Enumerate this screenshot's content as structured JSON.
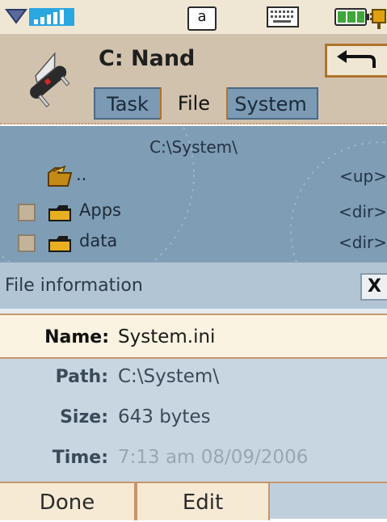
{
  "status_bar": {
    "input_mode": "a",
    "icons": [
      "signal-chevron-icon",
      "signal-bars-icon",
      "keyboard-icon",
      "battery-icon",
      "charger-plug-icon"
    ]
  },
  "header": {
    "drive_title": "C: Nand",
    "back_icon": "back-arrow-icon",
    "app_icon": "swiss-army-knife-icon",
    "tabs": [
      {
        "label": "Task"
      },
      {
        "label": "File",
        "active": true
      },
      {
        "label": "System"
      }
    ]
  },
  "folder_list": {
    "current_path": "C:\\System\\",
    "rows": [
      {
        "name": "..",
        "type": "<up>",
        "icon": "up-folder-icon",
        "checkbox": false
      },
      {
        "name": "Apps",
        "type": "<dir>",
        "icon": "folder-icon",
        "checkbox": true
      },
      {
        "name": "data",
        "type": "<dir>",
        "icon": "folder-icon",
        "checkbox": true
      }
    ]
  },
  "file_info": {
    "title": "File information",
    "close_label": "X",
    "fields": {
      "name": {
        "label": "Name:",
        "value": "System.ini"
      },
      "path": {
        "label": "Path:",
        "value": "C:\\System\\"
      },
      "size": {
        "label": "Size:",
        "value": "643 bytes"
      },
      "time": {
        "label": "Time:",
        "value": "7:13 am  08/09/2006"
      }
    }
  },
  "softkeys": {
    "done_label": "Done",
    "edit_label": "Edit"
  },
  "colors": {
    "header_bg": "#d1c2ae",
    "list_bg": "#7f9db4",
    "info_bg": "#c7d6e1",
    "accent_border": "#c8956b",
    "softkey_bg": "#f6ead5"
  }
}
